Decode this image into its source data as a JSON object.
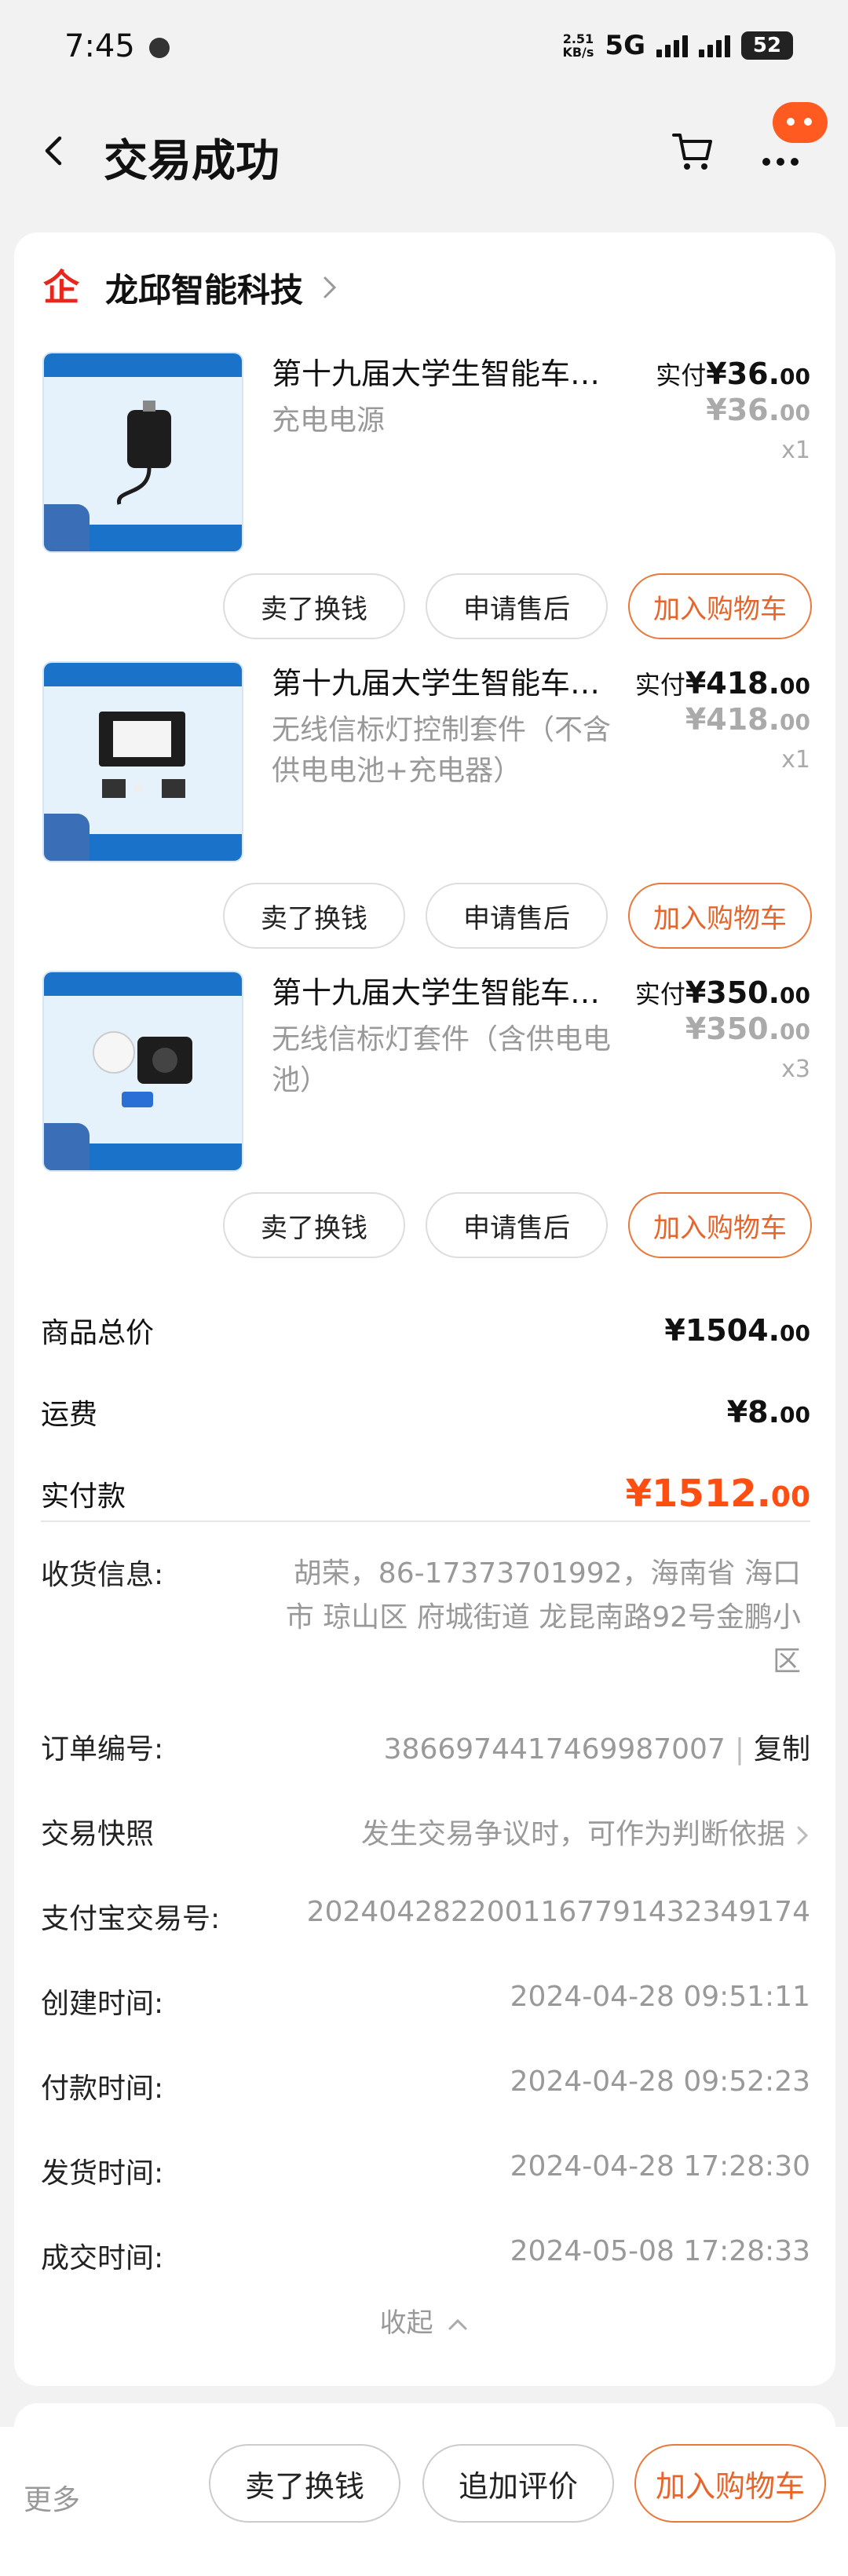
{
  "status": {
    "time": "7:45",
    "speed_top": "2.51",
    "speed_bottom": "KB/s",
    "network": "5G",
    "battery": "52"
  },
  "nav": {
    "title": "交易成功"
  },
  "shop": {
    "icon_glyph": "企",
    "name": "龙邱智能科技"
  },
  "items": [
    {
      "title": "第十九届大学生智能车…",
      "spec": "充电电源",
      "paid_label": "实付",
      "paid_int": "¥36.",
      "paid_dec": "00",
      "orig_int": "¥36.",
      "orig_dec": "00",
      "qty": "x1",
      "btn_sell": "卖了换钱",
      "btn_service": "申请售后",
      "btn_cart": "加入购物车"
    },
    {
      "title": "第十九届大学生智能车…",
      "spec": "无线信标灯控制套件（不含供电电池+充电器）",
      "paid_label": "实付",
      "paid_int": "¥418.",
      "paid_dec": "00",
      "orig_int": "¥418.",
      "orig_dec": "00",
      "qty": "x1",
      "btn_sell": "卖了换钱",
      "btn_service": "申请售后",
      "btn_cart": "加入购物车"
    },
    {
      "title": "第十九届大学生智能车…",
      "spec": "无线信标灯套件（含供电电池）",
      "paid_label": "实付",
      "paid_int": "¥350.",
      "paid_dec": "00",
      "orig_int": "¥350.",
      "orig_dec": "00",
      "qty": "x3",
      "btn_sell": "卖了换钱",
      "btn_service": "申请售后",
      "btn_cart": "加入购物车"
    }
  ],
  "summary": {
    "goods_label": "商品总价",
    "goods_int": "¥1504.",
    "goods_dec": "00",
    "shipping_label": "运费",
    "shipping_int": "¥8.",
    "shipping_dec": "00",
    "total_label": "实付款",
    "total_int": "¥1512.",
    "total_dec": "00"
  },
  "info": {
    "address_label": "收货信息:",
    "address_value": "胡荣，86-17373701992，海南省 海口市 琼山区 府城街道 龙昆南路92号金鹏小区",
    "order_label": "订单编号:",
    "order_value": "3866974417469987007",
    "order_sep": "|",
    "order_copy": "复制",
    "snapshot_label": "交易快照",
    "snapshot_value": "发生交易争议时，可作为判断依据",
    "alipay_label": "支付宝交易号:",
    "alipay_value": "2024042822001167791432349174",
    "created_label": "创建时间:",
    "created_value": "2024-04-28 09:51:11",
    "paid_label": "付款时间:",
    "paid_value": "2024-04-28 09:52:23",
    "shipped_label": "发货时间:",
    "shipped_value": "2024-04-28 17:28:30",
    "done_label": "成交时间:",
    "done_value": "2024-05-08 17:28:33",
    "collapse": "收起"
  },
  "bottom": {
    "more": "更多",
    "sell": "卖了换钱",
    "review": "追加评价",
    "cart": "加入购物车"
  },
  "colors": {
    "accent": "#ff4e12",
    "button_orange": "#e8642a",
    "shop_icon": "#e8261c",
    "notify": "#ff5a1f"
  }
}
